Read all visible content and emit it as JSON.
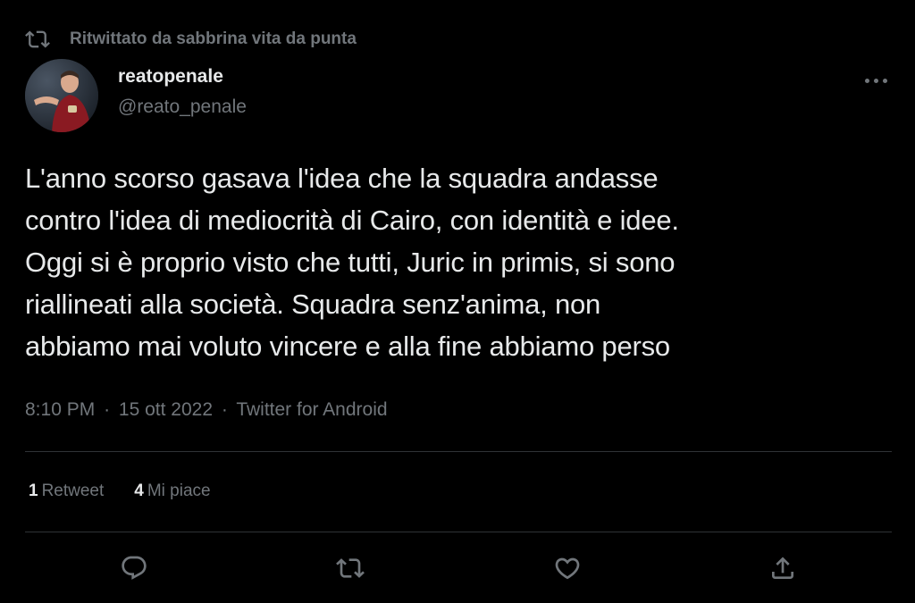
{
  "context": {
    "text": "Ritwittato da sabbrina vita da punta",
    "icon": "retweet-icon"
  },
  "author": {
    "display_name": "reatopenale",
    "handle": "@reato_penale",
    "avatar": "avatar"
  },
  "tweet": {
    "lines": [
      "L'anno scorso gasava l'idea che la squadra andasse",
      "contro l'idea di mediocrità di Cairo, con identità e idee.",
      "Oggi si è proprio visto che tutti, Juric in primis, si sono",
      "riallineati alla società. Squadra senz'anima, non",
      "abbiamo mai voluto vincere e alla fine abbiamo perso"
    ]
  },
  "meta": {
    "time": "8:10 PM",
    "separator": "·",
    "date": "15 ott 2022",
    "source": "Twitter for Android"
  },
  "stats": {
    "retweets_count": "1",
    "retweets_label": "Retweet",
    "likes_count": "4",
    "likes_label": "Mi piace"
  },
  "actions": [
    "reply-icon",
    "retweet-icon",
    "heart-icon",
    "share-icon"
  ],
  "colors": {
    "background": "#000000",
    "text_primary": "#e7e9ea",
    "text_secondary": "#71767b",
    "divider": "#2f3336"
  }
}
